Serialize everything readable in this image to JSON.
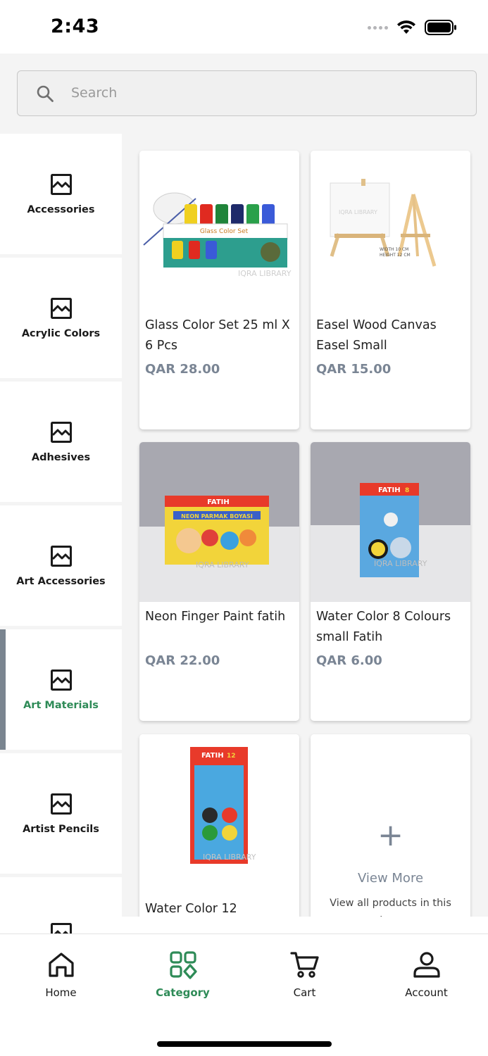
{
  "status_bar": {
    "time": "2:43"
  },
  "search": {
    "placeholder": "Search"
  },
  "categories": [
    {
      "label": "Accessories",
      "active": false
    },
    {
      "label": "Acrylic Colors",
      "active": false
    },
    {
      "label": "Adhesives",
      "active": false
    },
    {
      "label": "Art Accessories",
      "active": false
    },
    {
      "label": "Art Materials",
      "active": true
    },
    {
      "label": "Artist Pencils",
      "active": false
    },
    {
      "label": "",
      "active": false
    }
  ],
  "products": [
    {
      "name": "Glass Color Set 25 ml X 6 Pcs",
      "price": "QAR 28.00"
    },
    {
      "name": "Easel Wood Canvas Easel Small",
      "price": "QAR 15.00"
    },
    {
      "name": "Neon Finger Paint fatih",
      "price": "QAR 22.00"
    },
    {
      "name": "Water Color 8 Colours small Fatih",
      "price": "QAR 6.00"
    },
    {
      "name": "Water Color 12",
      "price": ""
    }
  ],
  "view_more": {
    "plus": "+",
    "title": "View More",
    "subtitle": "View all products in this category"
  },
  "bottom_nav": [
    {
      "label": "Home",
      "icon": "home-icon",
      "active": false
    },
    {
      "label": "Category",
      "icon": "category-icon",
      "active": true
    },
    {
      "label": "Cart",
      "icon": "cart-icon",
      "active": false
    },
    {
      "label": "Account",
      "icon": "account-icon",
      "active": false
    }
  ],
  "colors": {
    "accent": "#2e8b57",
    "price": "#7a8594",
    "active_bar": "#7a8590"
  }
}
